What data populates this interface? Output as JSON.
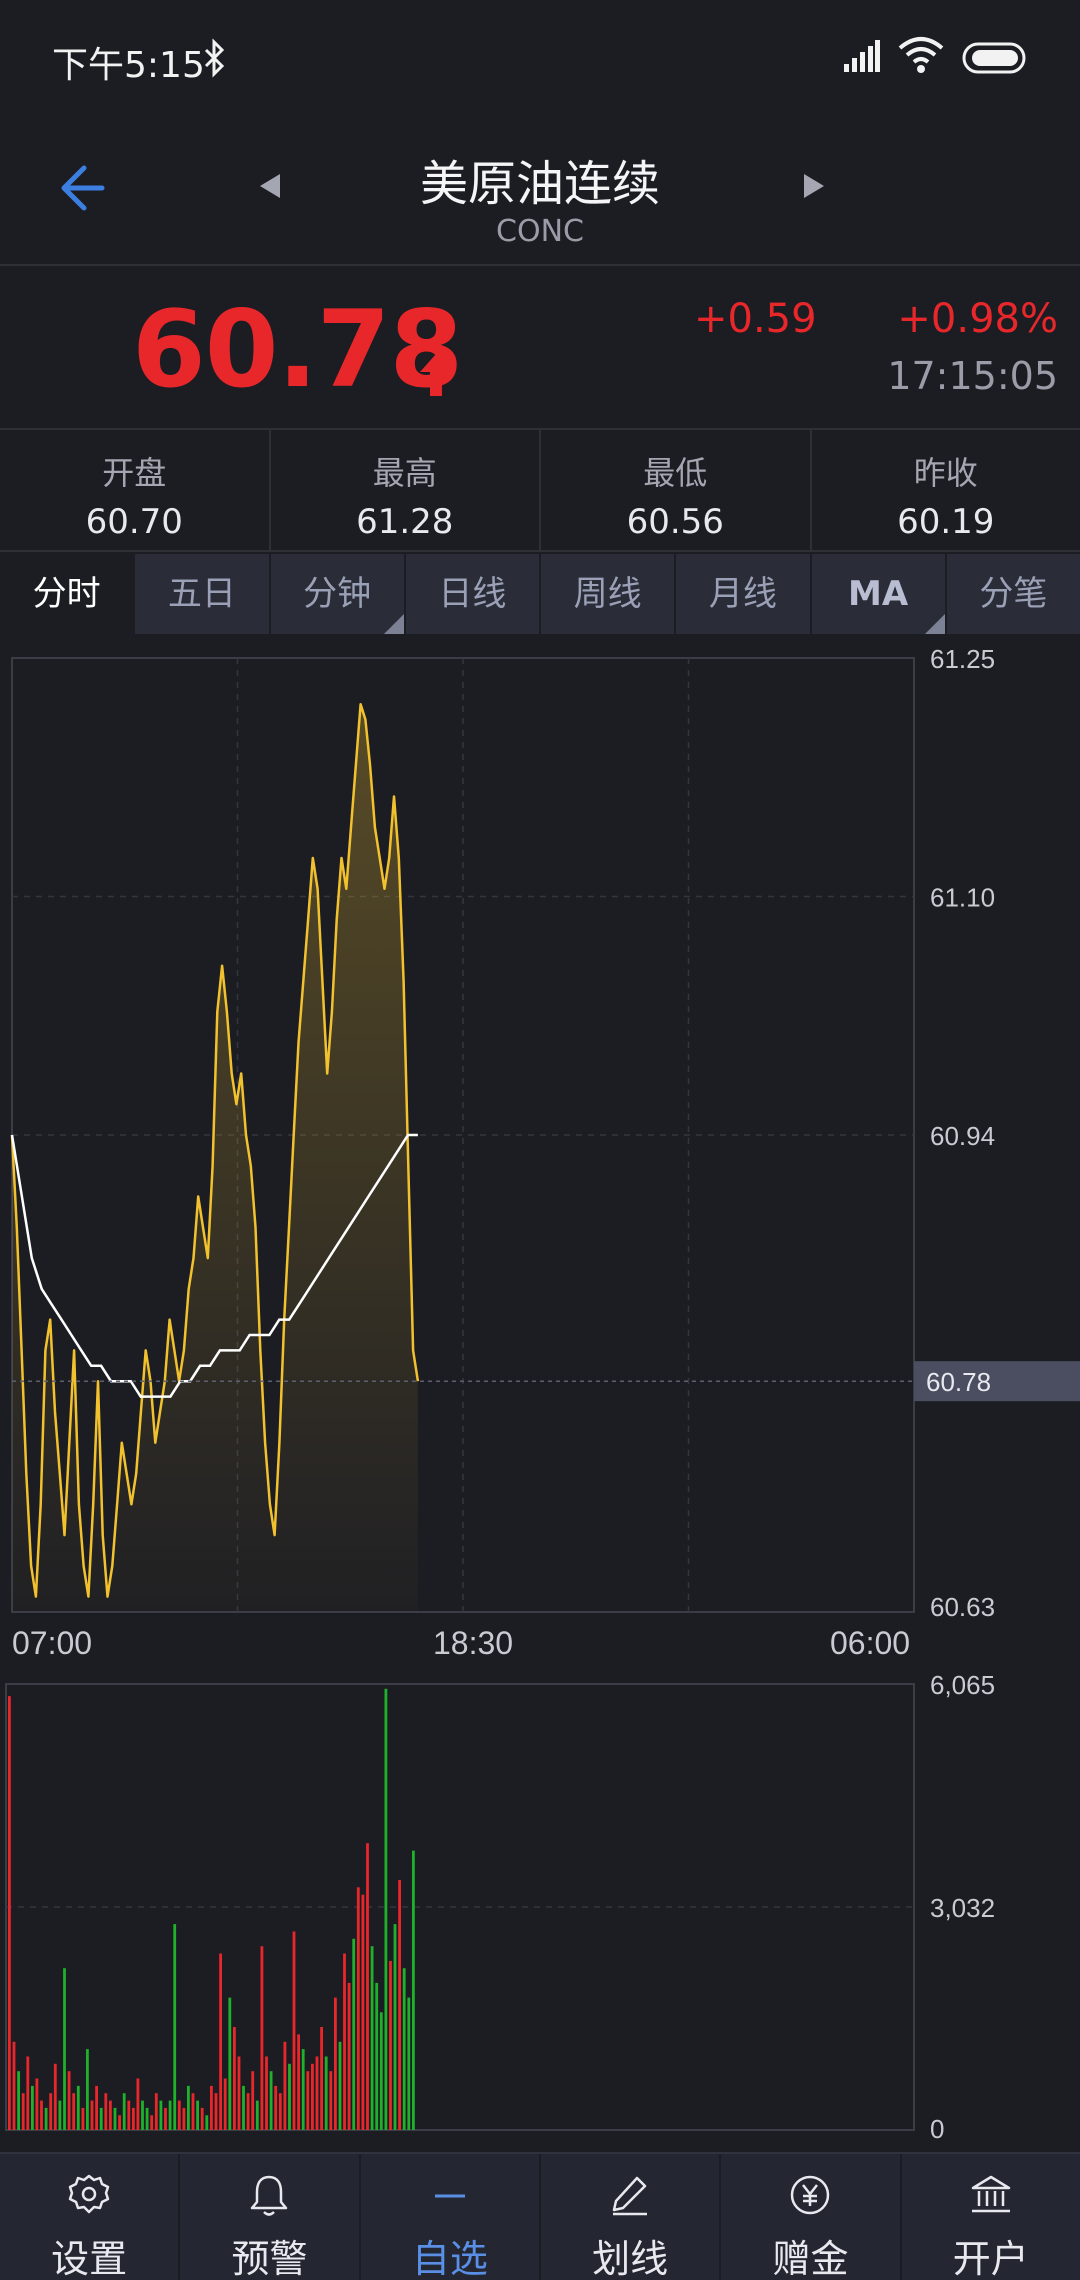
{
  "status_bar": {
    "time": "下午5:15"
  },
  "header": {
    "title": "美原油连续",
    "subtitle": "CONC"
  },
  "quote": {
    "price": "60.78",
    "change": "+0.59",
    "change_pct": "+0.98%",
    "time": "17:15:05",
    "up_color": "#e8272b"
  },
  "stats": [
    {
      "label": "开盘",
      "value": "60.70"
    },
    {
      "label": "最高",
      "value": "61.28"
    },
    {
      "label": "最低",
      "value": "60.56"
    },
    {
      "label": "昨收",
      "value": "60.19"
    }
  ],
  "tabs": [
    {
      "label": "分时",
      "active": true
    },
    {
      "label": "五日"
    },
    {
      "label": "分钟",
      "dropdown": true
    },
    {
      "label": "日线"
    },
    {
      "label": "周线"
    },
    {
      "label": "月线"
    },
    {
      "label": "MA",
      "dropdown": true
    },
    {
      "label": "分笔"
    }
  ],
  "chart_data": [
    {
      "type": "line",
      "y_ticks": [
        "61.25",
        "61.10",
        "60.94",
        "60.63"
      ],
      "current_label": "60.78",
      "x_ticks": [
        "07:00",
        "18:30",
        "06:00"
      ],
      "ylim": [
        60.63,
        61.25
      ],
      "series": [
        {
          "values": [
            60.94,
            60.88,
            60.8,
            60.72,
            60.66,
            60.64,
            60.7,
            60.8,
            60.82,
            60.76,
            60.72,
            60.68,
            60.74,
            60.8,
            60.7,
            60.66,
            60.64,
            60.7,
            60.78,
            60.68,
            60.64,
            60.66,
            60.7,
            60.74,
            60.72,
            60.7,
            60.72,
            60.76,
            60.8,
            60.78,
            60.74,
            60.76,
            60.78,
            60.82,
            60.8,
            60.78,
            60.8,
            60.84,
            60.86,
            60.9,
            60.88,
            60.86,
            60.92,
            61.02,
            61.05,
            61.02,
            60.98,
            60.96,
            60.98,
            60.94,
            60.92,
            60.88,
            60.8,
            60.74,
            60.7,
            60.68,
            60.74,
            60.82,
            60.88,
            60.94,
            61.0,
            61.04,
            61.08,
            61.12,
            61.1,
            61.04,
            60.98,
            61.02,
            61.08,
            61.12,
            61.1,
            61.14,
            61.18,
            61.22,
            61.21,
            61.18,
            61.14,
            61.12,
            61.1,
            61.12,
            61.16,
            61.12,
            61.04,
            60.92,
            60.8,
            60.78
          ],
          "color": "#f2c12e"
        },
        {
          "values": [
            60.94,
            60.9,
            60.86,
            60.84,
            60.83,
            60.82,
            60.81,
            60.8,
            60.79,
            60.79,
            60.78,
            60.78,
            60.78,
            60.77,
            60.77,
            60.77,
            60.77,
            60.78,
            60.78,
            60.79,
            60.79,
            60.8,
            60.8,
            60.8,
            60.81,
            60.81,
            60.81,
            60.82,
            60.82,
            60.83,
            60.84,
            60.85,
            60.86,
            60.87,
            60.88,
            60.89,
            60.9,
            60.91,
            60.92,
            60.93,
            60.94,
            60.94
          ],
          "color": "#ffffff"
        }
      ]
    },
    {
      "type": "bar",
      "y_ticks": [
        "6,065",
        "3,032",
        "0"
      ],
      "ylim": [
        0,
        6065
      ],
      "colors": {
        "up": "#e8272b",
        "down": "#1fb02c"
      },
      "bars": [
        [
          5900,
          1
        ],
        [
          1200,
          1
        ],
        [
          800,
          0
        ],
        [
          500,
          1
        ],
        [
          1000,
          1
        ],
        [
          600,
          0
        ],
        [
          700,
          1
        ],
        [
          400,
          1
        ],
        [
          300,
          0
        ],
        [
          500,
          1
        ],
        [
          900,
          1
        ],
        [
          400,
          0
        ],
        [
          2200,
          0
        ],
        [
          800,
          1
        ],
        [
          500,
          1
        ],
        [
          600,
          0
        ],
        [
          300,
          1
        ],
        [
          1100,
          0
        ],
        [
          400,
          1
        ],
        [
          600,
          1
        ],
        [
          300,
          0
        ],
        [
          500,
          1
        ],
        [
          400,
          1
        ],
        [
          300,
          0
        ],
        [
          200,
          1
        ],
        [
          500,
          0
        ],
        [
          400,
          1
        ],
        [
          300,
          1
        ],
        [
          700,
          1
        ],
        [
          400,
          0
        ],
        [
          300,
          0
        ],
        [
          200,
          1
        ],
        [
          500,
          1
        ],
        [
          400,
          0
        ],
        [
          300,
          1
        ],
        [
          400,
          0
        ],
        [
          2800,
          0
        ],
        [
          400,
          1
        ],
        [
          300,
          1
        ],
        [
          600,
          0
        ],
        [
          500,
          1
        ],
        [
          400,
          0
        ],
        [
          300,
          1
        ],
        [
          200,
          0
        ],
        [
          600,
          1
        ],
        [
          500,
          1
        ],
        [
          2400,
          1
        ],
        [
          700,
          1
        ],
        [
          1800,
          0
        ],
        [
          1400,
          1
        ],
        [
          1000,
          1
        ],
        [
          600,
          0
        ],
        [
          500,
          1
        ],
        [
          800,
          1
        ],
        [
          400,
          0
        ],
        [
          2500,
          1
        ],
        [
          1000,
          1
        ],
        [
          800,
          0
        ],
        [
          600,
          1
        ],
        [
          500,
          1
        ],
        [
          1200,
          1
        ],
        [
          900,
          0
        ],
        [
          2700,
          1
        ],
        [
          1300,
          1
        ],
        [
          1100,
          0
        ],
        [
          800,
          1
        ],
        [
          900,
          1
        ],
        [
          1000,
          1
        ],
        [
          1400,
          1
        ],
        [
          1000,
          0
        ],
        [
          800,
          1
        ],
        [
          1800,
          1
        ],
        [
          1200,
          0
        ],
        [
          2400,
          1
        ],
        [
          2000,
          1
        ],
        [
          2600,
          0
        ],
        [
          3300,
          1
        ],
        [
          3200,
          1
        ],
        [
          3900,
          1
        ],
        [
          2500,
          0
        ],
        [
          2000,
          0
        ],
        [
          1600,
          0
        ],
        [
          6000,
          0
        ],
        [
          2300,
          1
        ],
        [
          2800,
          0
        ],
        [
          3400,
          1
        ],
        [
          2200,
          0
        ],
        [
          1800,
          0
        ],
        [
          3800,
          0
        ]
      ]
    }
  ],
  "bottom_nav": [
    {
      "label": "设置",
      "icon": "gear-icon"
    },
    {
      "label": "预警",
      "icon": "bell-icon"
    },
    {
      "label": "自选",
      "icon": "minus-icon",
      "active": true
    },
    {
      "label": "划线",
      "icon": "pen-icon"
    },
    {
      "label": "赠金",
      "icon": "yen-coin-icon"
    },
    {
      "label": "开户",
      "icon": "bank-icon"
    }
  ]
}
